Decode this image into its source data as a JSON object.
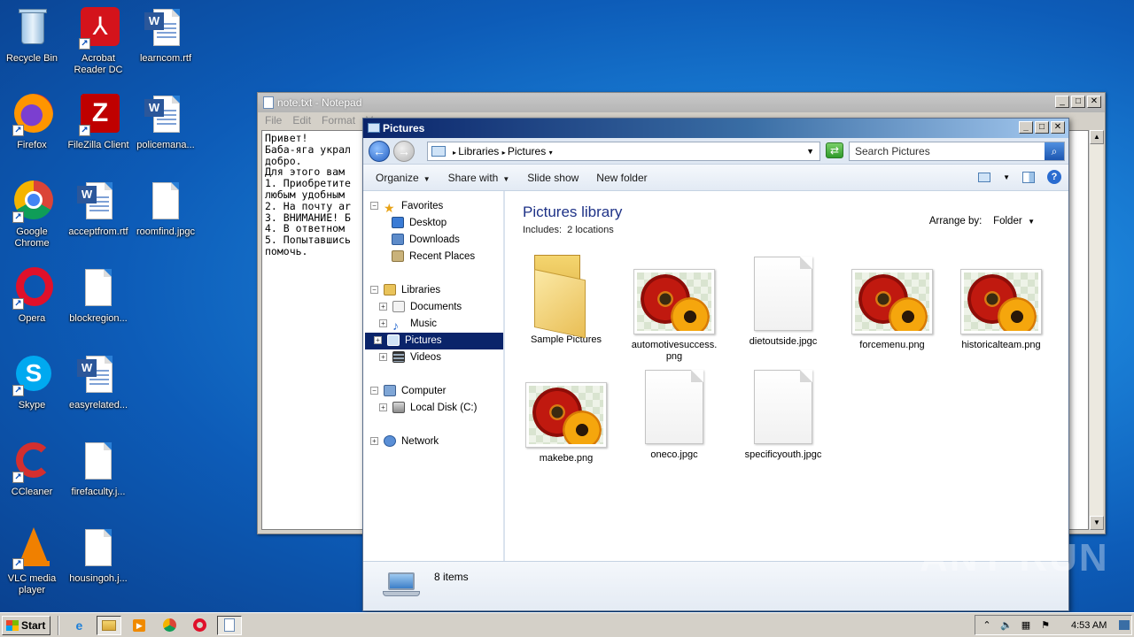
{
  "desktop": {
    "icons": [
      {
        "label": "Recycle Bin"
      },
      {
        "label": "Acrobat Reader DC"
      },
      {
        "label": "learncom.rtf"
      },
      {
        "label": "Firefox"
      },
      {
        "label": "FileZilla Client"
      },
      {
        "label": "policemana..."
      },
      {
        "label": "Google Chrome"
      },
      {
        "label": "acceptfrom.rtf"
      },
      {
        "label": "roomfind.jpgc"
      },
      {
        "label": "Opera"
      },
      {
        "label": "blockregion..."
      },
      {
        "label": "Skype"
      },
      {
        "label": "easyrelated..."
      },
      {
        "label": "CCleaner"
      },
      {
        "label": "firefaculty.j..."
      },
      {
        "label": "VLC media player"
      },
      {
        "label": "housingoh.j..."
      }
    ]
  },
  "notepad": {
    "title": "note.txt - Notepad",
    "menu": [
      "File",
      "Edit",
      "Format",
      "V"
    ],
    "text": "Привет!\nБаба-яга украл\nдобро.\nДля этого вам\n1. Приобретите\nлюбым удобным\n2. На почту ar\n3. ВНИМАНИЕ! Б\n4. В ответном\n5. Попытавшись\nпомочь."
  },
  "explorer": {
    "title": "Pictures",
    "breadcrumb": [
      "Libraries",
      "Pictures"
    ],
    "search_placeholder": "Search Pictures",
    "toolbar": {
      "organize": "Organize",
      "share_with": "Share with",
      "slide_show": "Slide show",
      "new_folder": "New folder"
    },
    "nav": {
      "favorites": "Favorites",
      "desktop": "Desktop",
      "downloads": "Downloads",
      "recent_places": "Recent Places",
      "libraries": "Libraries",
      "documents": "Documents",
      "music": "Music",
      "pictures": "Pictures",
      "videos": "Videos",
      "computer": "Computer",
      "local_disk": "Local Disk (C:)",
      "network": "Network"
    },
    "library": {
      "title": "Pictures library",
      "includes_label": "Includes:",
      "includes_link": "2 locations",
      "arrange_label": "Arrange by:",
      "arrange_value": "Folder"
    },
    "items": [
      {
        "name": "Sample Pictures",
        "kind": "folder"
      },
      {
        "name": "automotivesuccess.\npng",
        "kind": "image"
      },
      {
        "name": "dietoutside.jpgc",
        "kind": "blank"
      },
      {
        "name": "forcemenu.png",
        "kind": "image"
      },
      {
        "name": "historicalteam.png",
        "kind": "image"
      },
      {
        "name": "makebe.png",
        "kind": "image"
      },
      {
        "name": "oneco.jpgc",
        "kind": "blank"
      },
      {
        "name": "specificyouth.jpgc",
        "kind": "blank"
      }
    ],
    "status": "8 items"
  },
  "taskbar": {
    "start_label": "Start",
    "clock": "4:53 AM"
  },
  "watermark": "ANY RUN"
}
